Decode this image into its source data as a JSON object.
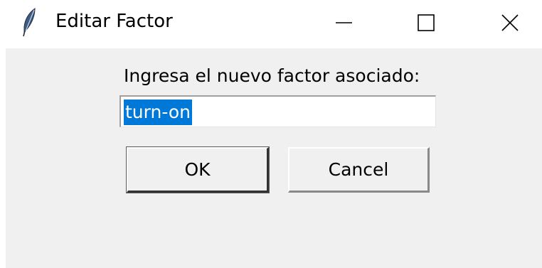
{
  "window": {
    "title": "Editar Factor",
    "icon": "feather-icon",
    "controls": {
      "minimize_icon": "minimize-icon",
      "maximize_icon": "maximize-icon",
      "close_icon": "close-icon"
    }
  },
  "dialog": {
    "prompt": "Ingresa el nuevo factor asociado:",
    "entry_value": "turn-on",
    "ok_label": "OK",
    "cancel_label": "Cancel"
  },
  "colors": {
    "client_background": "#f0f0f0",
    "selection_highlight": "#0078d7",
    "selection_text": "#ffffff"
  }
}
